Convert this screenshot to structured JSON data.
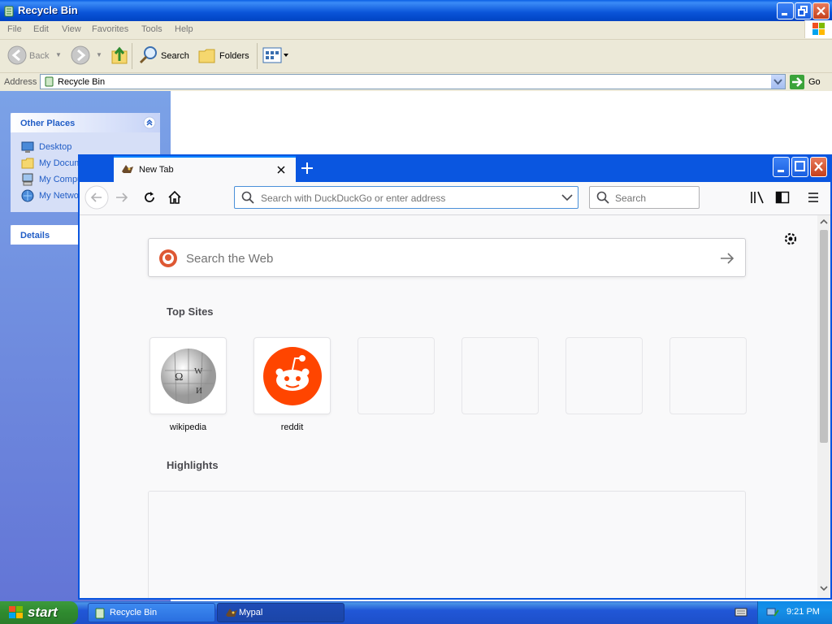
{
  "explorer": {
    "title": "Recycle Bin",
    "menu": [
      "File",
      "Edit",
      "View",
      "Favorites",
      "Tools",
      "Help"
    ],
    "toolbar": {
      "back": "Back",
      "search": "Search",
      "folders": "Folders"
    },
    "address": {
      "label": "Address",
      "value": "Recycle Bin",
      "go": "Go"
    },
    "sidebar": {
      "other_places_title": "Other Places",
      "links": [
        "Desktop",
        "My Documents",
        "My Computer",
        "My Network Places"
      ],
      "details_title": "Details"
    }
  },
  "firefox": {
    "tab": {
      "title": "New Tab"
    },
    "urlbar": {
      "placeholder": "Search with DuckDuckGo or enter address"
    },
    "searchbar": {
      "placeholder": "Search"
    },
    "newtab": {
      "web_search_placeholder": "Search the Web",
      "top_sites_title": "Top Sites",
      "top_sites": [
        {
          "label": "wikipedia"
        },
        {
          "label": "reddit"
        },
        {
          "label": ""
        },
        {
          "label": ""
        },
        {
          "label": ""
        },
        {
          "label": ""
        }
      ],
      "highlights_title": "Highlights"
    }
  },
  "taskbar": {
    "start": "start",
    "tasks": [
      "Recycle Bin",
      "Mypal"
    ],
    "clock": "9:21 PM"
  },
  "colors": {
    "xp_blue": "#0a54d8",
    "start_green": "#2f8a2f",
    "reddit_orange": "#ff4500",
    "ddg_orange": "#de5833",
    "link_blue": "#215dc6"
  }
}
